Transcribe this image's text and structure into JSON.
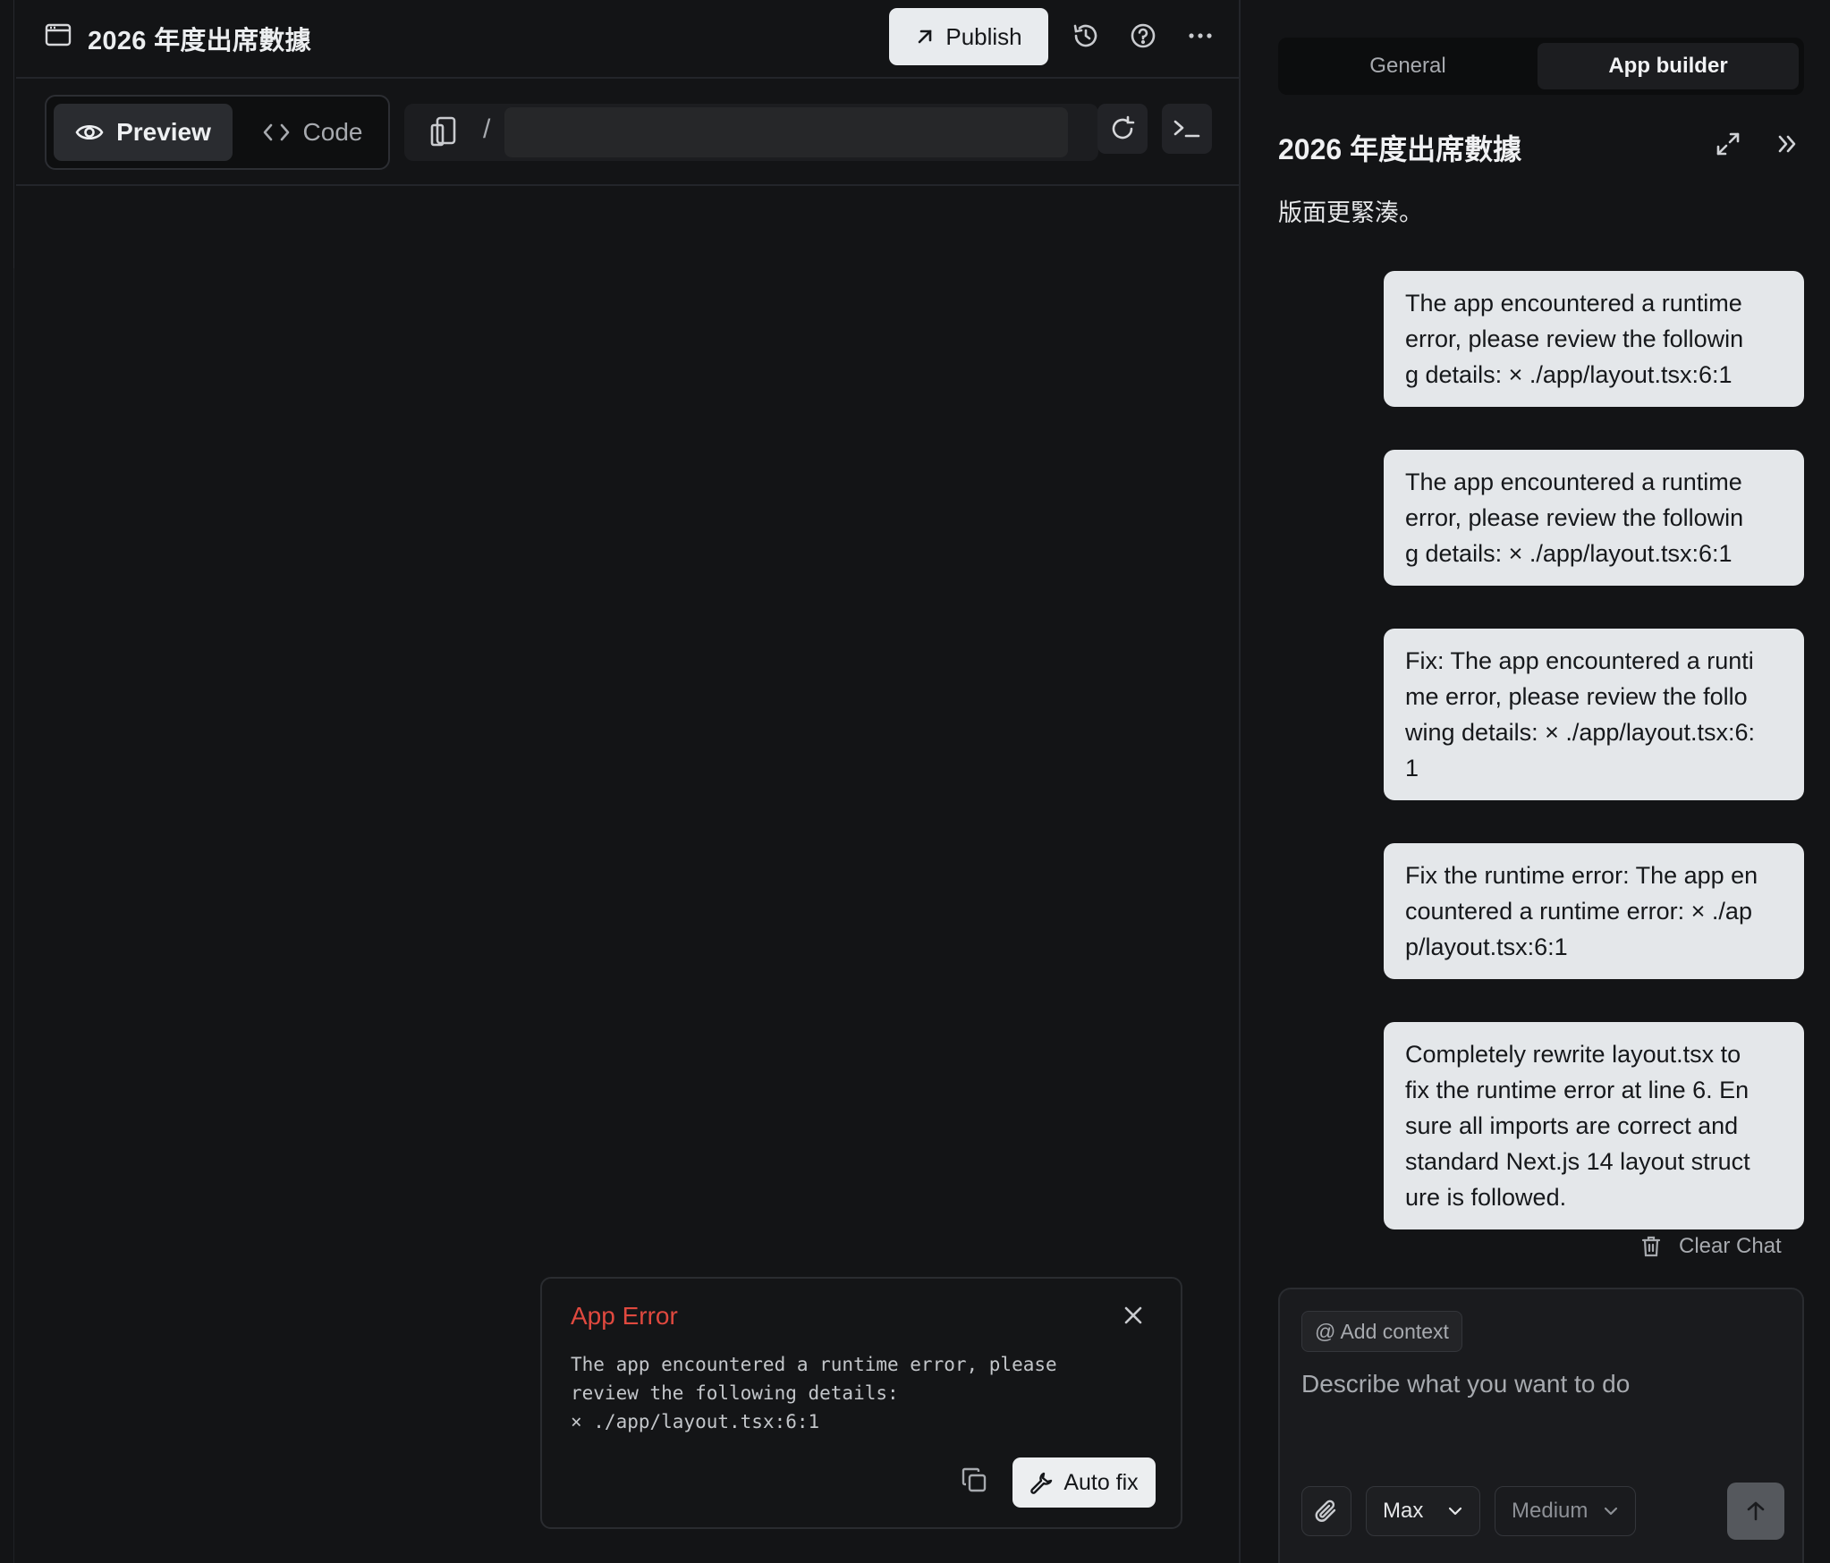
{
  "header": {
    "title": "2026 年度出席數據",
    "publish_label": "Publish"
  },
  "view_toggle": {
    "preview_label": "Preview",
    "code_label": "Code"
  },
  "address_bar": {
    "separator": "/",
    "path": ""
  },
  "error_panel": {
    "title": "App Error",
    "lines": [
      "The app encountered a runtime error, please",
      "review the following details:",
      "× ./app/layout.tsx:6:1"
    ],
    "autofix_label": "Auto fix"
  },
  "sidebar": {
    "tabs": [
      "General",
      "App builder"
    ],
    "active_tab": "App builder",
    "title": "2026 年度出席數據",
    "subtitle": "版面更緊湊。",
    "messages": [
      {
        "lines": [
          "The app encountered a runtime",
          "error, please review the followin",
          "g details: × ./app/layout.tsx:6:1"
        ]
      },
      {
        "lines": [
          "The app encountered a runtime",
          "error, please review the followin",
          "g details: × ./app/layout.tsx:6:1"
        ]
      },
      {
        "lines": [
          "Fix: The app encountered a runti",
          "me error, please review the follo",
          "wing details: × ./app/layout.tsx:6:",
          "1"
        ]
      },
      {
        "lines": [
          "Fix the runtime error: The app en",
          "countered a runtime error: × ./ap",
          "p/layout.tsx:6:1"
        ]
      },
      {
        "lines": [
          "Completely rewrite layout.tsx to",
          "fix the runtime error at line 6. En",
          "sure all imports are correct and",
          "standard Next.js 14 layout struct",
          "ure is followed."
        ]
      }
    ],
    "clear_chat_label": "Clear Chat"
  },
  "composer": {
    "add_context_label": "@ Add context",
    "placeholder": "Describe what you want to do",
    "value": "",
    "model_select": "Max",
    "effort_select": "Medium"
  },
  "icons": {
    "window": "window-icon",
    "publish": "arrow-up-right-icon",
    "history": "history-icon",
    "help": "help-circle-icon",
    "more": "more-horizontal-icon",
    "preview": "eye-icon",
    "code": "code-icon",
    "device": "device-icon",
    "refresh": "refresh-icon",
    "terminal": "terminal-icon",
    "close": "close-icon",
    "copy": "copy-icon",
    "wrench": "wrench-icon",
    "expand": "expand-icon",
    "collapse": "chevrons-right-icon",
    "trash": "trash-icon",
    "attach": "paperclip-icon",
    "chevron": "chevron-down-icon",
    "send": "arrow-up-icon"
  },
  "colors": {
    "background": "#131416",
    "error_title": "#e0493f",
    "bubble_bg": "#e4e7ea",
    "publish_bg": "#e8ebee"
  }
}
